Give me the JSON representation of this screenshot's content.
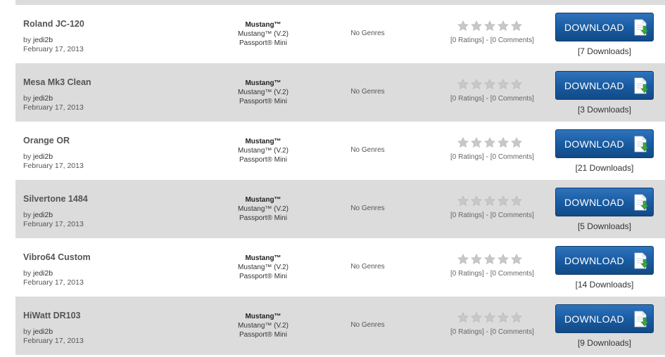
{
  "rows": [
    {
      "title": "Roland JC-120",
      "by_prefix": "by",
      "author": "jedi2b",
      "date": "February 17, 2013",
      "platforms": [
        "Mustang™",
        "Mustang™ (V.2)",
        "Passport® Mini"
      ],
      "genre": "No Genres",
      "rating": 0,
      "ratings_text": "[0 Ratings] - [0 Comments]",
      "download_label": "DOWNLOAD",
      "downloads_text": "[7 Downloads]"
    },
    {
      "title": "Mesa Mk3 Clean",
      "by_prefix": "by",
      "author": "jedi2b",
      "date": "February 17, 2013",
      "platforms": [
        "Mustang™",
        "Mustang™ (V.2)",
        "Passport® Mini"
      ],
      "genre": "No Genres",
      "rating": 0,
      "ratings_text": "[0 Ratings] - [0 Comments]",
      "download_label": "DOWNLOAD",
      "downloads_text": "[3 Downloads]"
    },
    {
      "title": "Orange OR",
      "by_prefix": "by",
      "author": "jedi2b",
      "date": "February 17, 2013",
      "platforms": [
        "Mustang™",
        "Mustang™ (V.2)",
        "Passport® Mini"
      ],
      "genre": "No Genres",
      "rating": 0,
      "ratings_text": "[0 Ratings] - [0 Comments]",
      "download_label": "DOWNLOAD",
      "downloads_text": "[21 Downloads]"
    },
    {
      "title": "Silvertone 1484",
      "by_prefix": "by",
      "author": "jedi2b",
      "date": "February 17, 2013",
      "platforms": [
        "Mustang™",
        "Mustang™ (V.2)",
        "Passport® Mini"
      ],
      "genre": "No Genres",
      "rating": 0,
      "ratings_text": "[0 Ratings] - [0 Comments]",
      "download_label": "DOWNLOAD",
      "downloads_text": "[5 Downloads]"
    },
    {
      "title": "Vibro64 Custom",
      "by_prefix": "by",
      "author": "jedi2b",
      "date": "February 17, 2013",
      "platforms": [
        "Mustang™",
        "Mustang™ (V.2)",
        "Passport® Mini"
      ],
      "genre": "No Genres",
      "rating": 0,
      "ratings_text": "[0 Ratings] - [0 Comments]",
      "download_label": "DOWNLOAD",
      "downloads_text": "[14 Downloads]"
    },
    {
      "title": "HiWatt DR103",
      "by_prefix": "by",
      "author": "jedi2b",
      "date": "February 17, 2013",
      "platforms": [
        "Mustang™",
        "Mustang™ (V.2)",
        "Passport® Mini"
      ],
      "genre": "No Genres",
      "rating": 0,
      "ratings_text": "[0 Ratings] - [0 Comments]",
      "download_label": "DOWNLOAD",
      "downloads_text": "[9 Downloads]"
    }
  ],
  "icons": {
    "star": "star-icon",
    "download": "download-file-icon"
  },
  "colors": {
    "row_alt_bg": "#dcdcdc",
    "button_blue": "#185a9f",
    "star_empty": "#c8c8c8",
    "download_arrow": "#3aa83a"
  }
}
